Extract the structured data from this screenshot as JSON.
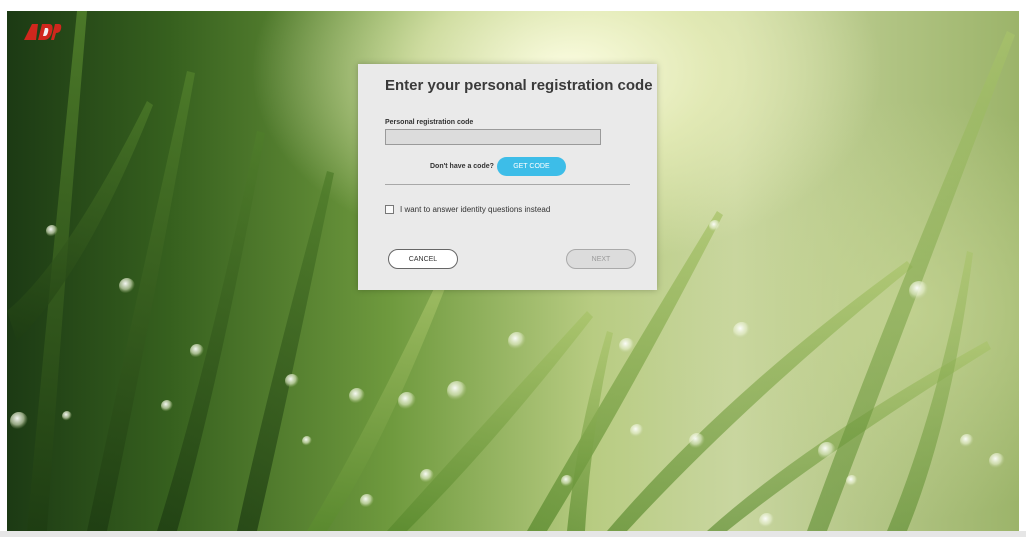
{
  "brand": {
    "logo_icon": "adp-logo-icon",
    "logo_text": "ADP",
    "logo_color": "#d0271d"
  },
  "dialog": {
    "title": "Enter your personal registration code",
    "field_label": "Personal registration code",
    "field_value": "",
    "get_code_prompt": "Don't have a code?",
    "get_code_label": "GET CODE",
    "checkbox_label": "I want to answer identity questions instead",
    "checkbox_checked": false,
    "cancel_label": "CANCEL",
    "next_label": "NEXT"
  },
  "colors": {
    "accent": "#3dbde8",
    "dialog_bg": "#eaeaea",
    "disabled": "#dcdcdc"
  },
  "footer": {
    "text": ""
  }
}
